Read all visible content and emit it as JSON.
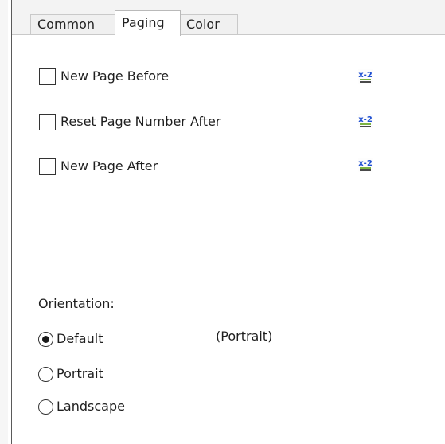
{
  "tabs": [
    {
      "label": "Common",
      "active": false
    },
    {
      "label": "Paging",
      "active": true
    },
    {
      "label": "Color",
      "active": false
    }
  ],
  "paging": {
    "checkboxes": [
      {
        "label": "New Page Before",
        "checked": false,
        "expression_icon": "expression-builder-icon"
      },
      {
        "label": "Reset Page Number After",
        "checked": false,
        "expression_icon": "expression-builder-icon"
      },
      {
        "label": "New Page After",
        "checked": false,
        "expression_icon": "expression-builder-icon"
      }
    ],
    "orientation": {
      "label": "Orientation:",
      "options": [
        {
          "label": "Default",
          "selected": true
        },
        {
          "label": "Portrait",
          "selected": false
        },
        {
          "label": "Landscape",
          "selected": false
        }
      ],
      "default_note": "(Portrait)"
    }
  },
  "colors": {
    "expression_icon_accent": "#1f4fd1",
    "expression_icon_bar": "#7cb342"
  }
}
